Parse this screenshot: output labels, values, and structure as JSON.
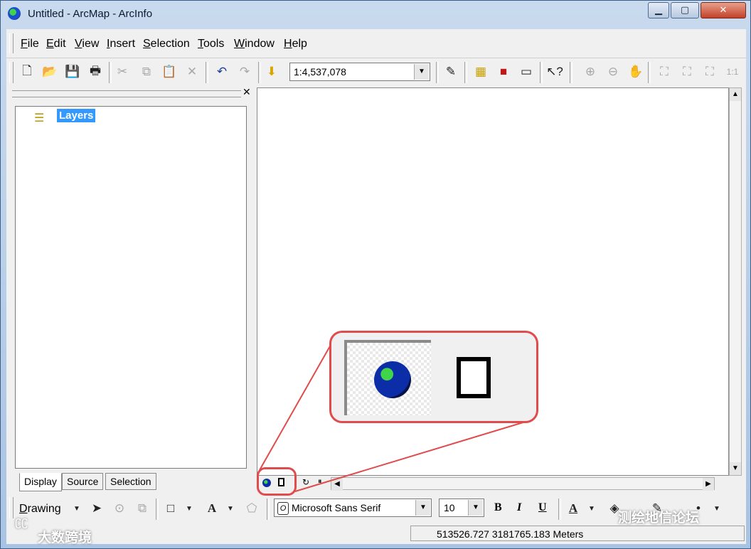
{
  "window": {
    "title": "Untitled - ArcMap - ArcInfo"
  },
  "menu": [
    "File",
    "Edit",
    "View",
    "Insert",
    "Selection",
    "Tools",
    "Window",
    "Help"
  ],
  "toolbar": {
    "scale": "1:4,537,078"
  },
  "toc": {
    "root_label": "Layers"
  },
  "toc_tabs": [
    "Display",
    "Source",
    "Selection"
  ],
  "drawing": {
    "label": "Drawing",
    "font": "Microsoft Sans Serif",
    "size": "10",
    "bold": "B",
    "italic": "I",
    "underline": "U",
    "text_tool": "A"
  },
  "status": {
    "coordinates": "513526.727  3181765.183 Meters"
  },
  "watermarks": {
    "left": "大数跨境",
    "right": "测绘地信论坛"
  },
  "colors": {
    "selection": "#3399ff",
    "callout": "#e14b4b"
  }
}
